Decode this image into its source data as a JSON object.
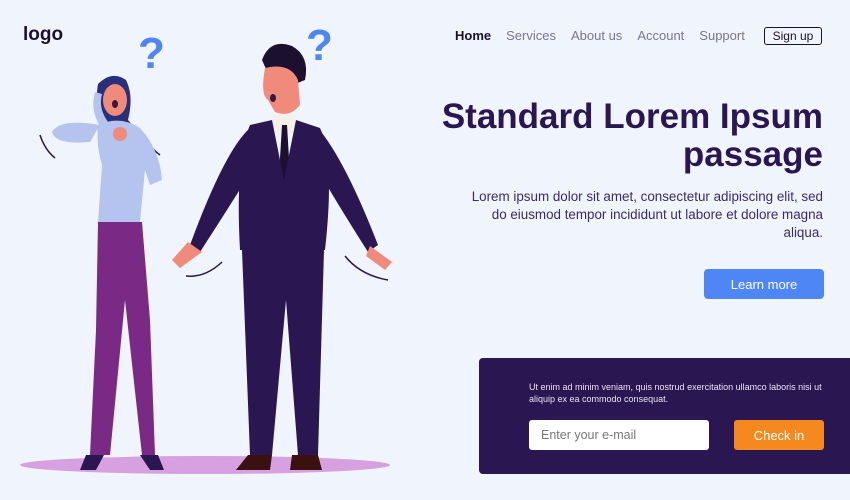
{
  "header": {
    "logo": "logo",
    "nav": [
      "Home",
      "Services",
      "About us",
      "Account",
      "Support"
    ],
    "active": "Home",
    "signup_label": "Sign up"
  },
  "hero": {
    "title": "Standard Lorem Ipsum passage",
    "description": "Lorem ipsum dolor sit amet, consectetur adipiscing elit, sed do eiusmod tempor incididunt ut labore et dolore magna aliqua.",
    "cta_label": "Learn more"
  },
  "subscribe": {
    "text": "Ut enim ad minim veniam, quis nostrud exercitation ullamco laboris nisi ut aliquip ex ea commodo consequat.",
    "email_placeholder": "Enter your e-mail",
    "button_label": "Check in"
  },
  "colors": {
    "background": "#f0f4fd",
    "primary_dark": "#2a1650",
    "accent_blue": "#4f86f5",
    "accent_orange": "#f5891f",
    "shadow_pink": "#d7a0e0"
  },
  "illustration": {
    "question_mark_1": "?",
    "question_mark_2": "?"
  }
}
